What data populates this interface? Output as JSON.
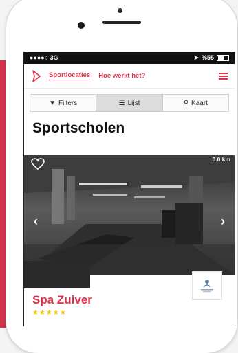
{
  "status_bar": {
    "carrier": "●●●●○ 3G",
    "battery": "%55"
  },
  "nav": {
    "items": [
      {
        "label": "Sportlocaties"
      },
      {
        "label": "Hoe werkt het?"
      }
    ]
  },
  "tabs": [
    {
      "label": "Filters"
    },
    {
      "label": "Lijst"
    },
    {
      "label": "Kaart"
    }
  ],
  "page_title": "Sportscholen",
  "card": {
    "distance": "0.0 km",
    "name": "Spa Zuiver",
    "rating": "★★★★★",
    "logo_caption": "spa zuiver"
  },
  "colors": {
    "accent": "#e0324b",
    "star": "#f2c200"
  },
  "icons": [
    "logo-icon",
    "hamburger-icon",
    "filter-icon",
    "list-icon",
    "map-pin-icon",
    "heart-icon",
    "chevron-left-icon",
    "chevron-right-icon"
  ]
}
